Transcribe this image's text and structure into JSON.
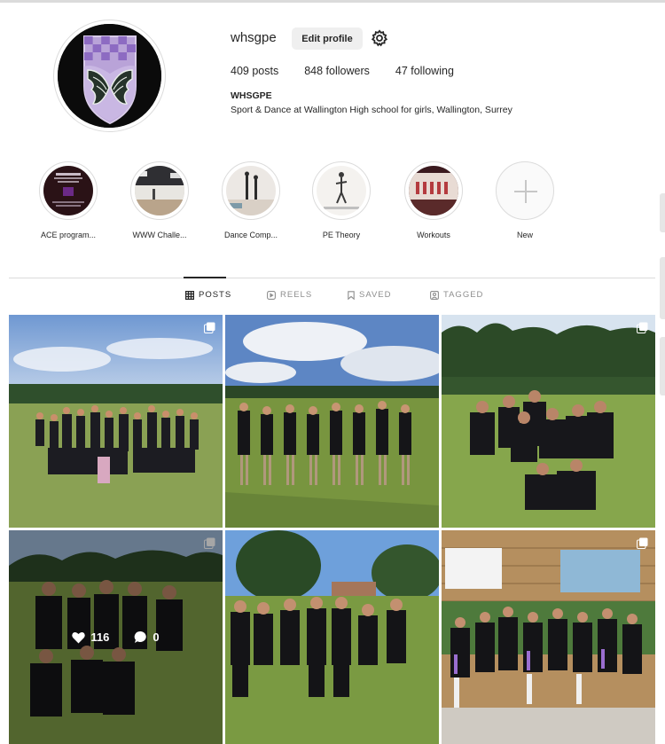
{
  "profile": {
    "username": "whsgpe",
    "edit_label": "Edit profile",
    "stats": {
      "posts": "409 posts",
      "followers": "848 followers",
      "following": "47 following"
    },
    "full_name": "WHSGPE",
    "bio": "Sport & Dance at Wallington High school for girls, Wallington, Surrey"
  },
  "highlights": [
    {
      "label": "ACE program...",
      "icon": "ace-programme-cover"
    },
    {
      "label": "WWW Challe...",
      "icon": "gym-hall-cover"
    },
    {
      "label": "Dance Comp...",
      "icon": "dance-studio-cover"
    },
    {
      "label": "PE Theory",
      "icon": "pe-theory-cover"
    },
    {
      "label": "Workouts",
      "icon": "workout-stage-cover"
    },
    {
      "label": "New",
      "icon": "plus-icon"
    }
  ],
  "tabs": [
    {
      "label": "POSTS",
      "icon": "grid-icon",
      "active": true
    },
    {
      "label": "REELS",
      "icon": "reels-icon",
      "active": false
    },
    {
      "label": "SAVED",
      "icon": "bookmark-icon",
      "active": false
    },
    {
      "label": "TAGGED",
      "icon": "tagged-icon",
      "active": false
    }
  ],
  "posts": [
    {
      "description": "team photo celebrating on field",
      "multi": true
    },
    {
      "description": "team lined up on field under cloudy sky",
      "multi": false
    },
    {
      "description": "group of players posing on grass",
      "multi": true
    },
    {
      "description": "group of players posing by trees",
      "multi": true,
      "hover": {
        "likes": "116",
        "comments": "0"
      }
    },
    {
      "description": "team standing in row on field",
      "multi": false
    },
    {
      "description": "team cheering in front of Cricket Club sign",
      "multi": true
    }
  ],
  "colors": {
    "text": "#262626",
    "muted": "#8e8e8e",
    "border": "#dbdbdb",
    "button_bg": "#efefef",
    "purple": "#8a6bbf"
  }
}
